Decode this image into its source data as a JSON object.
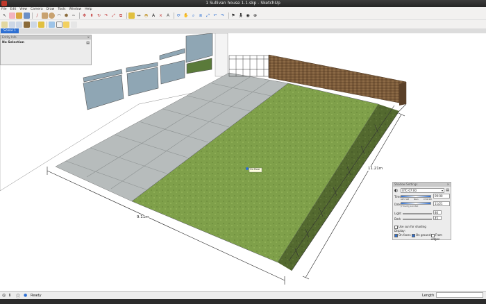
{
  "window": {
    "title": "1 Sullivan house 1.1.skp - SketchUp"
  },
  "menu": [
    "File",
    "Edit",
    "View",
    "Camera",
    "Draw",
    "Tools",
    "Window",
    "Help"
  ],
  "toolbar_row1": [
    "select-icon",
    "eraser-icon",
    "paint-bucket-icon",
    "make-component-icon",
    "line-icon",
    "rectangle-icon",
    "circle-icon",
    "arc-icon",
    "polygon-icon",
    "freehand-icon",
    "move-icon",
    "push-pull-icon",
    "rotate-icon",
    "follow-me-icon",
    "scale-icon",
    "offset-icon",
    "tape-measure-icon",
    "dimension-icon",
    "protractor-icon",
    "text-icon",
    "axes-icon",
    "3d-text-icon",
    "orbit-icon",
    "pan-icon",
    "zoom-icon",
    "zoom-window-icon",
    "zoom-extents-icon",
    "previous-view-icon",
    "next-view-icon",
    "position-camera-icon",
    "walk-icon",
    "look-around-icon",
    "section-plane-icon"
  ],
  "toolbar_row2": [
    "top-view-icon",
    "front-view-icon",
    "right-view-icon",
    "back-view-icon",
    "left-view-icon",
    "iso-view-icon",
    "xray-icon",
    "wireframe-icon",
    "shaded-icon",
    "textured-icon"
  ],
  "scene": {
    "tab": "Scene 1"
  },
  "entity_info": {
    "title": "Entity Info",
    "selection": "No Selection"
  },
  "model": {
    "dim_short": "9.11m",
    "dim_long": "11.21m",
    "snap_label": "On Face"
  },
  "shadows": {
    "title": "Shadow Settings",
    "timezone": "UTC-07:00",
    "time_label": "Time",
    "time_value": "09:00",
    "time_scale_left": "04:57 AM",
    "time_scale_noon": "Noon",
    "time_scale_right": "07:08 PM",
    "date_label": "Date",
    "date_value": "11/21",
    "date_scale": "J F M A M J J A S O N D",
    "light_label": "Light",
    "light_value": "80",
    "dark_label": "Dark",
    "dark_value": "45",
    "use_sun_label": "Use sun for shading",
    "display_label": "Display:",
    "on_faces": "On faces",
    "on_ground": "On ground",
    "from_edges": "From edges"
  },
  "status": {
    "text": "Ready",
    "length_label": "Length"
  }
}
